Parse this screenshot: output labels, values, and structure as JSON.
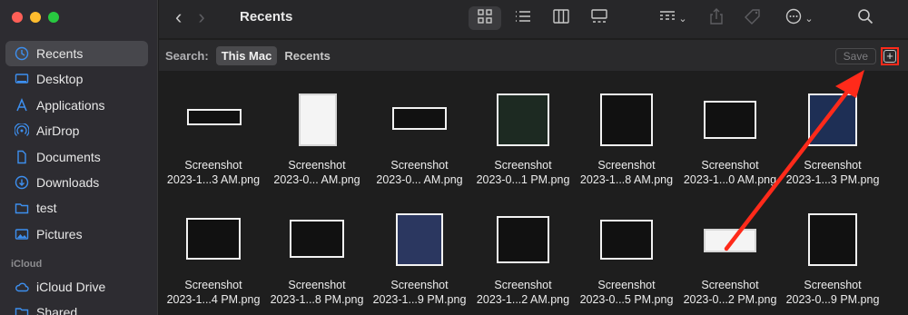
{
  "sidebar": {
    "favorites": [
      {
        "label": "Recents",
        "icon": "clock-icon",
        "active": true
      },
      {
        "label": "Desktop",
        "icon": "desktop-icon"
      },
      {
        "label": "Applications",
        "icon": "applications-icon"
      },
      {
        "label": "AirDrop",
        "icon": "airdrop-icon"
      },
      {
        "label": "Documents",
        "icon": "document-icon"
      },
      {
        "label": "Downloads",
        "icon": "download-icon"
      },
      {
        "label": "test",
        "icon": "folder-icon"
      },
      {
        "label": "Pictures",
        "icon": "pictures-icon"
      }
    ],
    "icloud_header": "iCloud",
    "icloud": [
      {
        "label": "iCloud Drive",
        "icon": "cloud-icon"
      },
      {
        "label": "Shared",
        "icon": "shared-folder-icon"
      }
    ]
  },
  "toolbar": {
    "title": "Recents",
    "back": "‹",
    "forward": "›"
  },
  "search": {
    "label": "Search:",
    "scope_this_mac": "This Mac",
    "scope_recents": "Recents",
    "save_label": "Save",
    "add_label": "+"
  },
  "files": [
    {
      "line1": "Screenshot",
      "line2": "2023-1...3 AM.png"
    },
    {
      "line1": "Screenshot",
      "line2": "2023-0... AM.png"
    },
    {
      "line1": "Screenshot",
      "line2": "2023-0... AM.png"
    },
    {
      "line1": "Screenshot",
      "line2": "2023-0...1 PM.png"
    },
    {
      "line1": "Screenshot",
      "line2": "2023-1...8 AM.png"
    },
    {
      "line1": "Screenshot",
      "line2": "2023-1...0 AM.png"
    },
    {
      "line1": "Screenshot",
      "line2": "2023-1...3 PM.png"
    },
    {
      "line1": "Screenshot",
      "line2": "2023-1...4 PM.png"
    },
    {
      "line1": "Screenshot",
      "line2": "2023-1...8 PM.png"
    },
    {
      "line1": "Screenshot",
      "line2": "2023-1...9 PM.png"
    },
    {
      "line1": "Screenshot",
      "line2": "2023-1...2 AM.png"
    },
    {
      "line1": "Screenshot",
      "line2": "2023-0...5 PM.png"
    },
    {
      "line1": "Screenshot",
      "line2": "2023-0...2 PM.png"
    },
    {
      "line1": "Screenshot",
      "line2": "2023-0...9 PM.png"
    }
  ],
  "colors": {
    "accent": "#3d8fef",
    "annotation": "#ff2a1a"
  }
}
